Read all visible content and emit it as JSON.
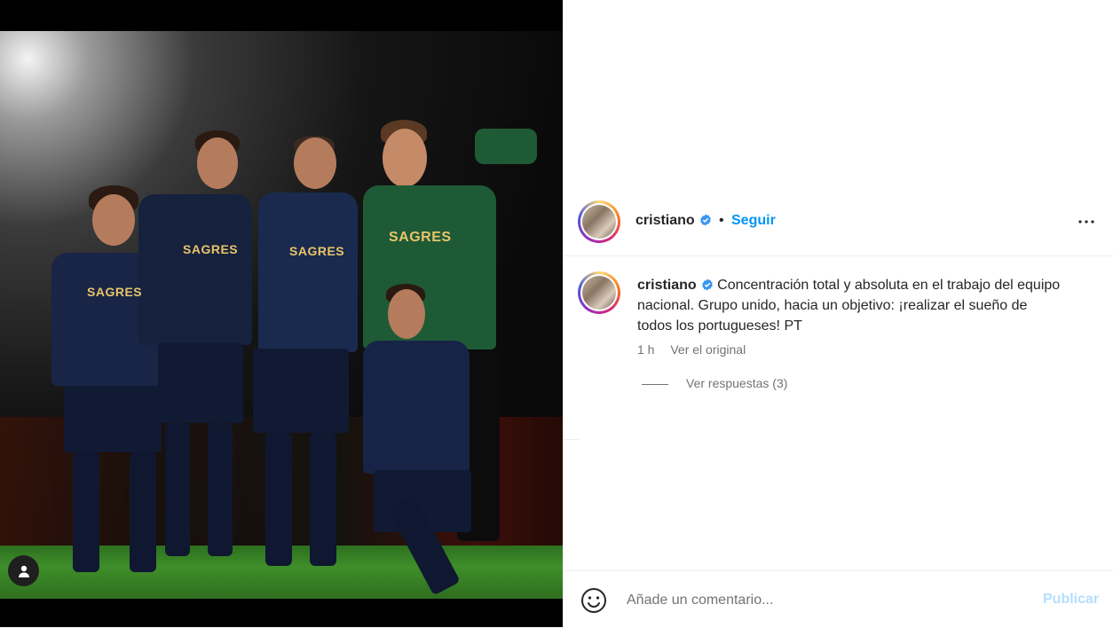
{
  "post": {
    "author": "cristiano",
    "follow_label": "Seguir",
    "separator": "•",
    "media_sponsor_text": "SAGRES"
  },
  "caption": {
    "username": "cristiano",
    "text": "Concentración total y absoluta en el trabajo del equipo nacional. Grupo unido, hacia un objetivo: ¡realizar el sueño de todos los portugueses! PT",
    "time": "1 h",
    "see_original": "Ver el original",
    "view_replies": "Ver respuestas (3)"
  },
  "composer": {
    "placeholder": "Añade un comentario...",
    "publish_label": "Publicar"
  },
  "colors": {
    "link_blue": "#0095f6",
    "publish_disabled": "#b2dffc",
    "verified_blue": "#3897f0"
  },
  "icons": {
    "more": "more-horizontal-icon",
    "emoji": "emoji-icon",
    "user": "user-icon",
    "verified": "verified-badge-icon"
  }
}
